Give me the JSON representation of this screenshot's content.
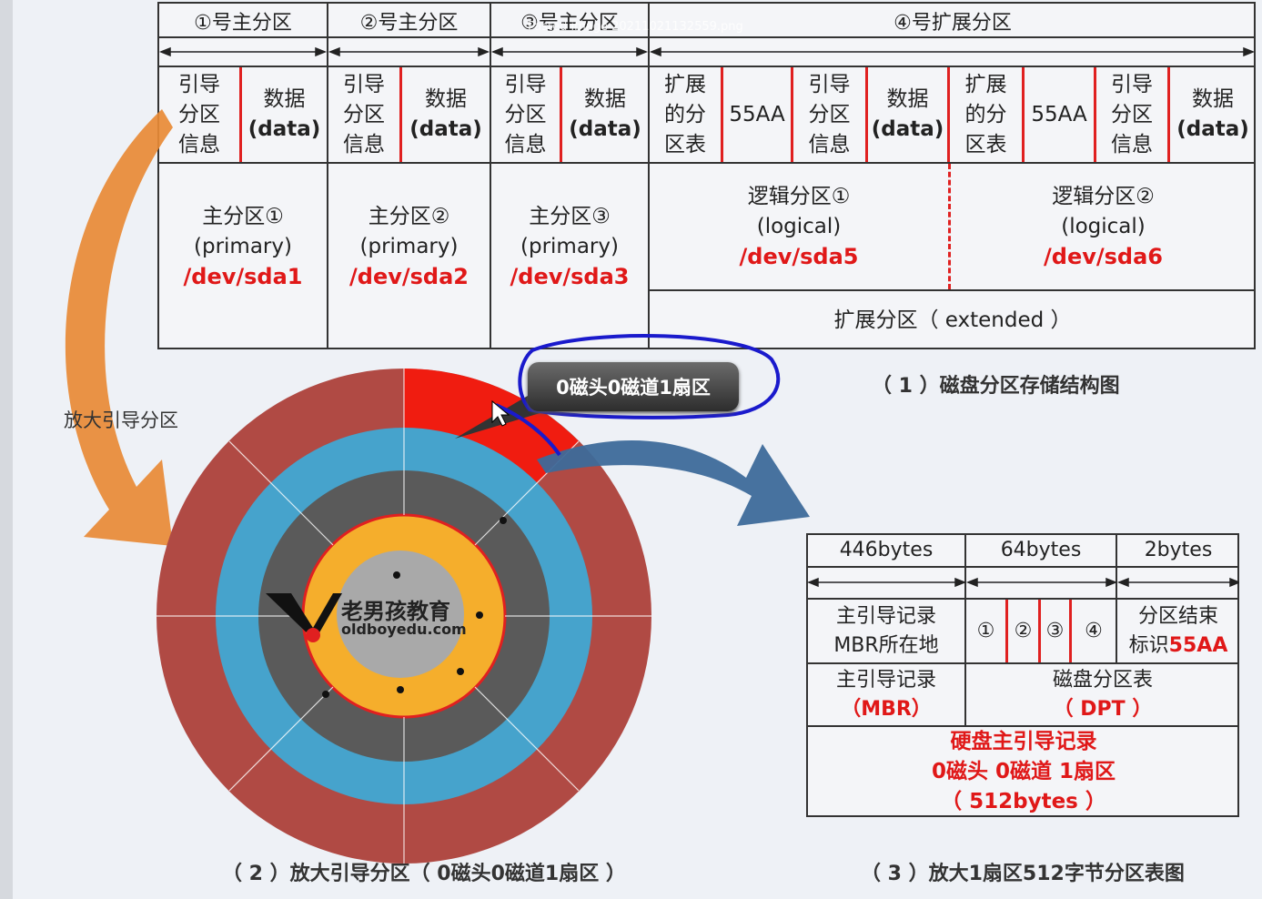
{
  "watermark": "Pasted image 20211021132559.png",
  "top": {
    "headers": [
      "①号主分区",
      "②号主分区",
      "③号主分区",
      "④号扩展分区"
    ],
    "boot_info": [
      "引导",
      "分区",
      "信息"
    ],
    "data_cn": "数据",
    "data_en": "(data)",
    "ext_table": [
      "扩展",
      "的分",
      "区表"
    ],
    "sig": "55AA",
    "primaries": [
      {
        "name": "主分区①",
        "type": "(primary)",
        "dev": "/dev/sda1"
      },
      {
        "name": "主分区②",
        "type": "(primary)",
        "dev": "/dev/sda2"
      },
      {
        "name": "主分区③",
        "type": "(primary)",
        "dev": "/dev/sda3"
      }
    ],
    "logicals": [
      {
        "name": "逻辑分区①",
        "type": "(logical)",
        "dev": "/dev/sda5"
      },
      {
        "name": "逻辑分区②",
        "type": "(logical)",
        "dev": "/dev/sda6"
      }
    ],
    "extended_label": "扩展分区（ extended ）"
  },
  "captions": {
    "c1": "（ 1 ）磁盘分区存储结构图",
    "c2": "（ 2 ）放大引导分区（ 0磁头0磁道1扇区 ）",
    "c3": "（ 3 ）放大1扇区512字节分区表图"
  },
  "callout": "0磁头0磁道1扇区",
  "side_label": "放大引导分区",
  "logo": {
    "cn": "老男孩教育",
    "en": "oldboyedu.com"
  },
  "mbr": {
    "sizes": [
      "446bytes",
      "64bytes",
      "2bytes"
    ],
    "boot_loc": [
      "主引导记录",
      "MBR所在地"
    ],
    "slots": [
      "①",
      "②",
      "③",
      "④"
    ],
    "end_mark": "分区结束",
    "end_mark2": "标识",
    "end_sig": "55AA",
    "mbr_label": "主引导记录",
    "mbr_abbr": "（MBR）",
    "dpt_label": "磁盘分区表",
    "dpt_abbr": "（ DPT ）",
    "footer": [
      "硬盘主引导记录",
      "0磁头 0磁道 1扇区",
      "（ 512bytes ）"
    ]
  },
  "colors": {
    "accent_red": "#e01818",
    "ring_outer": "#b04a44",
    "ring_blue": "#46a3cc",
    "ring_dark": "#5a5a5a",
    "ring_orange": "#f5ae2c",
    "callout_outline": "#1a1acc",
    "arrow_orange": "#e88a35",
    "arrow_blue": "#3d6a9a"
  }
}
